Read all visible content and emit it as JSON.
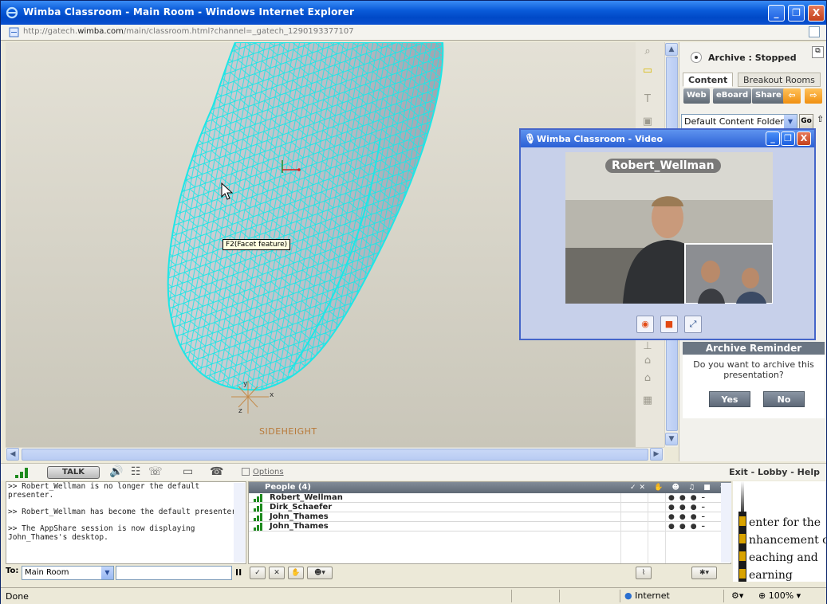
{
  "window": {
    "title": "Wimba Classroom - Main Room - Windows Internet Explorer",
    "minimize_glyph": "_",
    "maximize_glyph": "❐",
    "close_glyph": "X"
  },
  "address": {
    "prefix": "http://gatech.",
    "domain": "wimba.com",
    "rest": "/main/classroom.html?channel=_gatech_1290193377107"
  },
  "viewport": {
    "tooltip": "F2(Facet feature)",
    "axis_label": "SIDEHEIGHT",
    "axis_x": "x",
    "axis_y": "y",
    "axis_z": "z"
  },
  "right_panel": {
    "archive_status": "Archive : Stopped",
    "tabs": [
      {
        "label": "Content"
      },
      {
        "label": "Breakout Rooms"
      }
    ],
    "content_buttons": {
      "web": "Web",
      "eboard": "eBoard",
      "share": "Share"
    },
    "folder_select": "Default Content Folder",
    "go_label": "Go",
    "reminder": {
      "title": "Archive Reminder",
      "message": "Do you want to archive this presentation?",
      "yes": "Yes",
      "no": "No"
    }
  },
  "video_window": {
    "title": "Wimba Classroom - Video",
    "presenter_name": "Robert_Wellman"
  },
  "bottom_toolbar": {
    "talk_label": "TALK",
    "options_label": "Options",
    "links": "Exit - Lobby - Help"
  },
  "chat": {
    "messages": [
      ">> Robert_Wellman is no longer the default presenter.",
      ">> Robert_Wellman has become the default presenter.",
      ">> The AppShare session is now displaying John_Thames's desktop."
    ],
    "to_label": "To:",
    "room": "Main Room"
  },
  "people": {
    "header": "People (4)",
    "members": [
      {
        "name": "Robert_Wellman"
      },
      {
        "name": "Dirk_Schaefer"
      },
      {
        "name": "John_Thames"
      },
      {
        "name": "John_Thames"
      }
    ]
  },
  "logo": {
    "lines": [
      "enter for the",
      "nhancement of",
      "eaching and",
      "earning"
    ]
  },
  "status": {
    "text": "Done",
    "zone": "Internet",
    "zoom": "100%"
  },
  "colors": {
    "mesh": "#1ee6e6",
    "titlebar": "#0a5bd9",
    "logo_accent": "#d9a300"
  }
}
